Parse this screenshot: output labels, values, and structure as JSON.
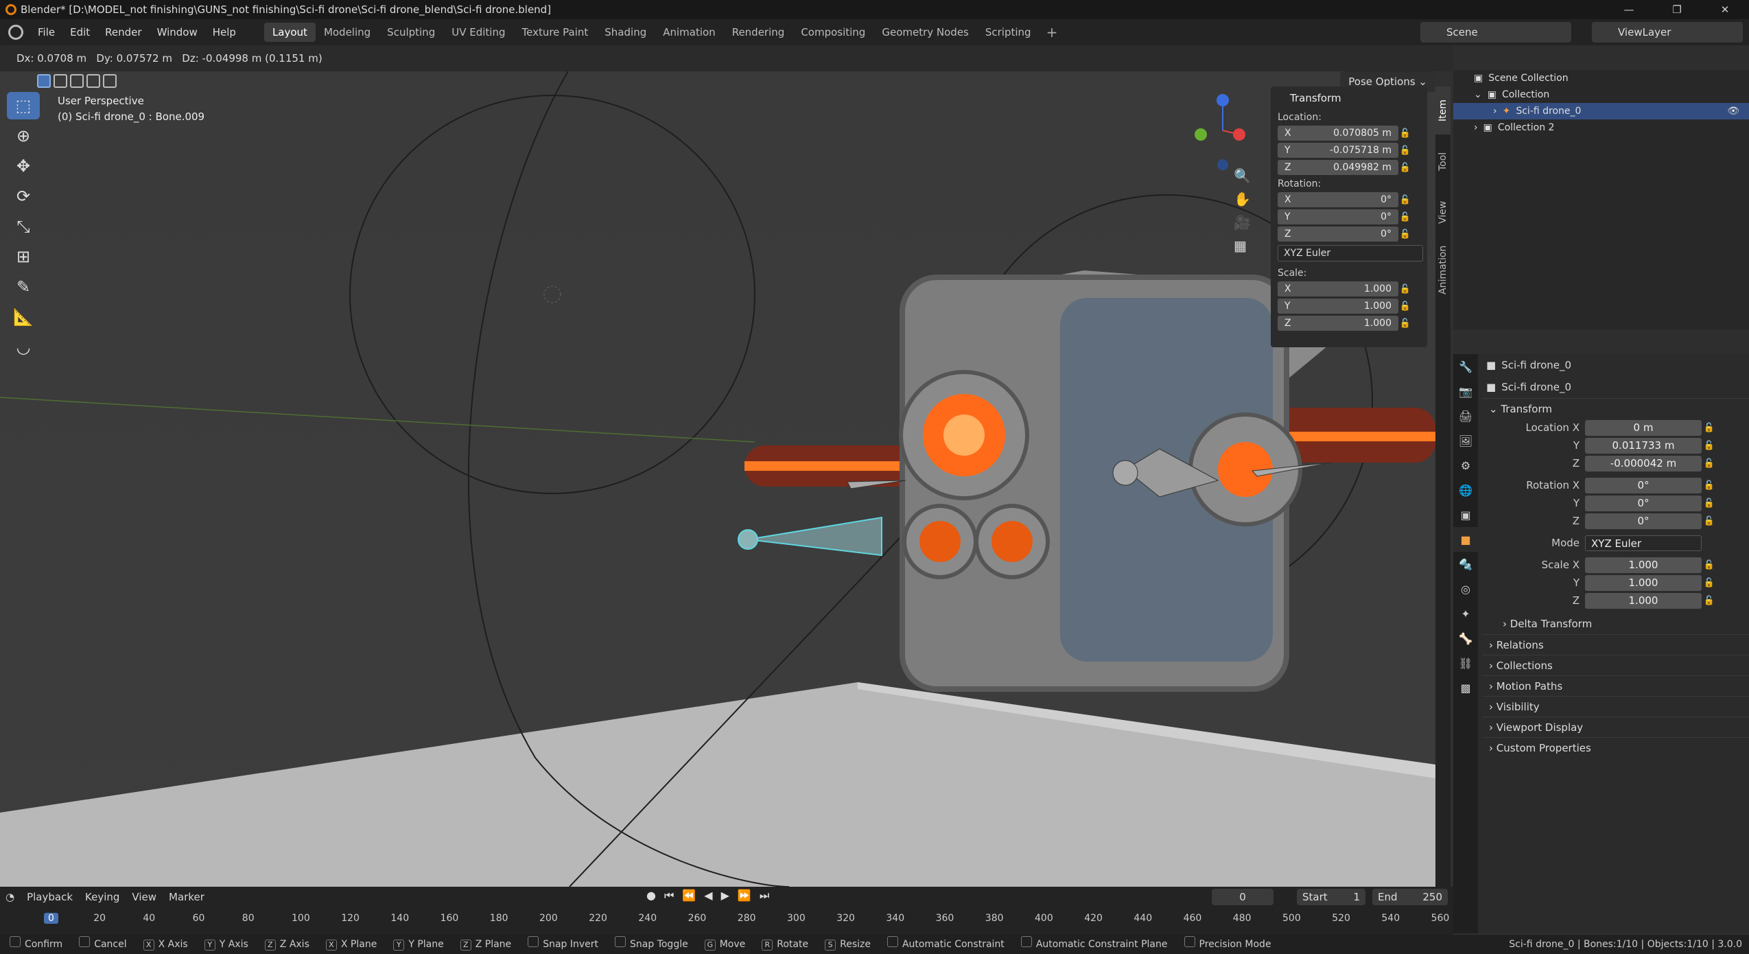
{
  "window": {
    "title": "Blender* [D:\\MODEL_not finishing\\GUNS_not finishing\\Sci-fi drone\\Sci-fi drone_blend\\Sci-fi drone.blend]"
  },
  "menu": [
    "File",
    "Edit",
    "Render",
    "Window",
    "Help"
  ],
  "workspaces": [
    "Layout",
    "Modeling",
    "Sculpting",
    "UV Editing",
    "Texture Paint",
    "Shading",
    "Animation",
    "Rendering",
    "Compositing",
    "Geometry Nodes",
    "Scripting"
  ],
  "scene": {
    "name": "Scene",
    "view_layer": "ViewLayer"
  },
  "viewport": {
    "header_text": "Dx: 0.0708 m   Dy: 0.07572 m   Dz: -0.04998 m (0.1151 m)",
    "perspective": "User Perspective",
    "object_info": "(0) Sci-fi drone_0 : Bone.009",
    "pose_options": "Pose Options"
  },
  "npanel": {
    "tabs": [
      "Item",
      "Tool",
      "View",
      "Animation"
    ],
    "title": "Transform",
    "location_label": "Location:",
    "location": [
      "0.070805 m",
      "-0.075718 m",
      "0.049982 m"
    ],
    "rotation_label": "Rotation:",
    "rotation": [
      "0°",
      "0°",
      "0°"
    ],
    "rotation_mode": "XYZ Euler",
    "scale_label": "Scale:",
    "scale": [
      "1.000",
      "1.000",
      "1.000"
    ],
    "axes": [
      "X",
      "Y",
      "Z"
    ]
  },
  "outliner": {
    "scene_collection": "Scene Collection",
    "collection": "Collection",
    "object": "Sci-fi drone_0",
    "collection2": "Collection 2"
  },
  "properties": {
    "object_name": "Sci-fi drone_0",
    "data_name": "Sci-fi drone_0",
    "transform_title": "Transform",
    "location_x_label": "Location X",
    "location": [
      "0 m",
      "0.011733 m",
      "-0.000042 m"
    ],
    "rotation_x_label": "Rotation X",
    "rotation": [
      "0°",
      "0°",
      "0°"
    ],
    "mode_label": "Mode",
    "mode": "XYZ Euler",
    "scale_x_label": "Scale X",
    "scale": [
      "1.000",
      "1.000",
      "1.000"
    ],
    "y_label": "Y",
    "z_label": "Z",
    "sections": [
      "Delta Transform",
      "Relations",
      "Collections",
      "Motion Paths",
      "Visibility",
      "Viewport Display",
      "Custom Properties"
    ]
  },
  "timeline": {
    "menus": [
      "Playback",
      "Keying",
      "View",
      "Marker"
    ],
    "current_frame": "0",
    "start_label": "Start",
    "start": "1",
    "end_label": "End",
    "end": "250",
    "ruler": [
      "0",
      "20",
      "40",
      "60",
      "80",
      "100",
      "120",
      "140",
      "160",
      "180",
      "200",
      "220",
      "240",
      "260",
      "280",
      "300",
      "320",
      "340",
      "360",
      "380",
      "400",
      "420",
      "440",
      "460",
      "480",
      "500",
      "520",
      "540",
      "560"
    ]
  },
  "statusbar": {
    "keys": [
      {
        "k": "",
        "t": "Confirm"
      },
      {
        "k": "",
        "t": "Cancel"
      },
      {
        "k": "X",
        "t": "X Axis"
      },
      {
        "k": "Y",
        "t": "Y Axis"
      },
      {
        "k": "Z",
        "t": "Z Axis"
      },
      {
        "k": "X",
        "t": "X Plane"
      },
      {
        "k": "Y",
        "t": "Y Plane"
      },
      {
        "k": "Z",
        "t": "Z Plane"
      },
      {
        "k": "",
        "t": "Snap Invert"
      },
      {
        "k": "",
        "t": "Snap Toggle"
      },
      {
        "k": "G",
        "t": "Move"
      },
      {
        "k": "R",
        "t": "Rotate"
      },
      {
        "k": "S",
        "t": "Resize"
      },
      {
        "k": "",
        "t": "Automatic Constraint"
      },
      {
        "k": "",
        "t": "Automatic Constraint Plane"
      },
      {
        "k": "",
        "t": "Precision Mode"
      }
    ],
    "right": "Sci-fi drone_0 | Bones:1/10 | Objects:1/10 | 3.0.0"
  }
}
